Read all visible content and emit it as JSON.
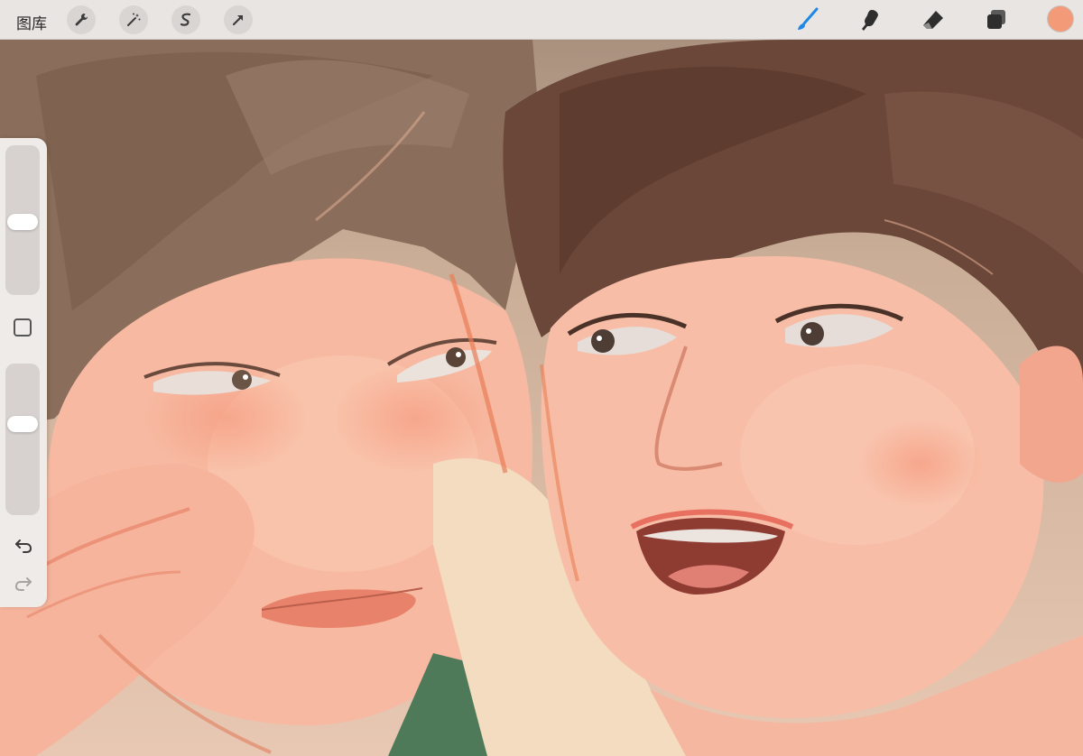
{
  "toolbar": {
    "gallery_label": "图库",
    "left_tools": [
      "wrench-icon",
      "magic-wand-icon",
      "selection-icon",
      "transform-arrow-icon"
    ],
    "right_tools": [
      "brush-icon",
      "smudge-icon",
      "eraser-icon",
      "layers-icon"
    ],
    "active_tool": "brush-icon",
    "active_color": "#f39a78",
    "brush_tool_color": "#1e88e5"
  },
  "sidebar": {
    "brush_size_level": 0.55,
    "opacity_level": 0.41
  }
}
